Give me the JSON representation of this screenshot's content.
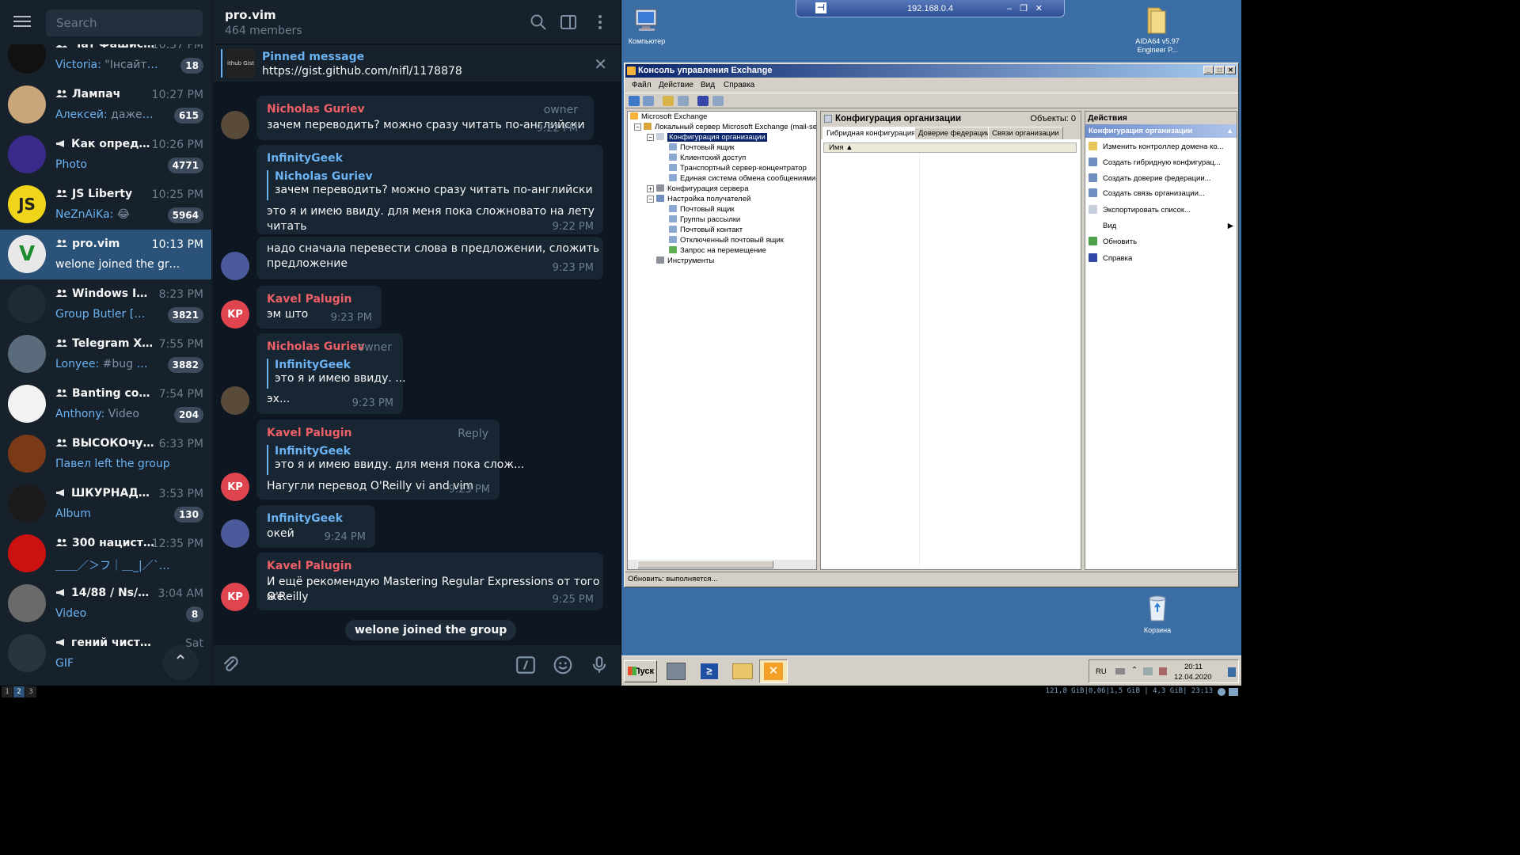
{
  "telegram": {
    "search_placeholder": "Search",
    "chats": [
      {
        "name": "Чат Фашисто...",
        "time": "10:37 PM",
        "sender": "Victoria:",
        "preview": " \"Інсайт\" як зав...",
        "badge": "18",
        "kind": "group",
        "avatar_color": "#111111",
        "avatar_text": "",
        "active": false
      },
      {
        "name": "Лампач",
        "time": "10:27 PM",
        "sender": "Алексей:",
        "preview": " даже не вып...",
        "badge": "615",
        "kind": "group",
        "avatar_color": "#c9a57a",
        "avatar_text": "",
        "active": false
      },
      {
        "name": "Как определи...",
        "time": "10:26 PM",
        "sender": "Photo",
        "preview": "",
        "badge": "4771",
        "kind": "channel",
        "avatar_color": "#3a2a8a",
        "avatar_text": "",
        "active": false
      },
      {
        "name": "JS Liberty",
        "time": "10:25 PM",
        "sender": "NeZnAiKa:",
        "preview": " 😂",
        "badge": "5964",
        "kind": "group",
        "avatar_color": "#f0d419",
        "avatar_text": "JS",
        "active": false
      },
      {
        "name": "pro.vim",
        "time": "10:13 PM",
        "sender": "welone joined the group",
        "preview": "",
        "badge": "",
        "kind": "group",
        "avatar_color": "#e8e8e8",
        "avatar_text": "V",
        "active": true
      },
      {
        "name": "Windows Inside...",
        "time": "8:23 PM",
        "sender": "Group Butler [beta]:",
        "preview": " ...",
        "badge": "3821",
        "kind": "group",
        "avatar_color": "#1f2a36",
        "avatar_text": "",
        "active": false
      },
      {
        "name": "Telegram X And...",
        "time": "7:55 PM",
        "sender": "Lonyee:",
        "preview": " #bug Telegra...",
        "badge": "3882",
        "kind": "group",
        "avatar_color": "#5a6b7c",
        "avatar_text": "",
        "active": false
      },
      {
        "name": "Banting cornerc...",
        "time": "7:54 PM",
        "sender": "Anthony:",
        "preview": " Video",
        "badge": "204",
        "kind": "group",
        "avatar_color": "#f2f2f2",
        "avatar_text": "",
        "active": false
      },
      {
        "name": "ВЫСОКОчувст...",
        "time": "6:33 PM",
        "sender": "Павел left the group",
        "preview": "",
        "badge": "",
        "kind": "group",
        "avatar_color": "#7a3a18",
        "avatar_text": "",
        "active": false
      },
      {
        "name": "ШКУРНАДЗОР",
        "time": "3:53 PM",
        "sender": "Album",
        "preview": "",
        "badge": "130",
        "kind": "channel",
        "avatar_color": "#1a1a1a",
        "avatar_text": "",
        "active": false
      },
      {
        "name": "300 нацистов",
        "time": "12:35 PM",
        "sender": "＿＿／＞フ｜＿_|／`ミ _x ...",
        "preview": "",
        "badge": "",
        "kind": "group",
        "avatar_color": "#cc1111",
        "avatar_text": "",
        "active": false
      },
      {
        "name": "14/88 / Ns/Wp P...",
        "time": "3:04 AM",
        "sender": "Video",
        "preview": "",
        "badge": "8",
        "kind": "channel",
        "avatar_color": "#6a6a6a",
        "avatar_text": "",
        "active": false
      },
      {
        "name": "гений чистой крас...",
        "time": "Sat",
        "sender": "GIF",
        "preview": "",
        "badge": "",
        "kind": "channel",
        "avatar_color": "#2a3440",
        "avatar_text": "",
        "active": false
      }
    ],
    "conversation": {
      "title": "pro.vim",
      "members": "464 members",
      "pinned_title": "Pinned message",
      "pinned_text": "https://gist.github.com/nifl/1178878",
      "pinned_thumb": "ithub Gist",
      "messages": [
        {
          "author": "Nicholas Guriev",
          "role": "owner",
          "text": "зачем переводить? можно сразу читать по-английски",
          "time": "9:22 PM"
        },
        {
          "author": "InfinityGeek",
          "quote_author": "Nicholas Guriev",
          "quote_text": "зачем переводить? можно сразу читать по-английски",
          "text": "это я и имею ввиду. для меня пока сложновато на лету читать",
          "time": "9:22 PM"
        },
        {
          "text_line1": "надо сначала перевести слова в предложении, сложить",
          "text_line2": "предложение",
          "time": "9:23 PM"
        },
        {
          "author": "Kavel Palugin",
          "avatar_text": "KP",
          "text": "эм што",
          "time": "9:23 PM"
        },
        {
          "author": "Nicholas Guriev",
          "role": "owner",
          "quote_author": "InfinityGeek",
          "quote_text": "это я и имею ввиду. ...",
          "text": "эх...",
          "time": "9:23 PM"
        },
        {
          "author": "Kavel Palugin",
          "avatar_text": "KP",
          "reply_label": "Reply",
          "quote_author": "InfinityGeek",
          "quote_text": "это я и имею ввиду. для меня пока слож...",
          "text": "Нагугли перевод O'Reilly vi and vim",
          "time": "9:23 PM"
        },
        {
          "author": "InfinityGeek",
          "text": "окей",
          "time": "9:24 PM"
        },
        {
          "author": "Kavel Palugin",
          "avatar_text": "KP",
          "text_line1": "И ещё рекомендую Mastering Regular Expressions от того же",
          "text_line2": "O'Reilly",
          "time": "9:25 PM"
        }
      ],
      "service_message": "welone joined the group"
    }
  },
  "windows": {
    "rdp_host": "192.168.0.4",
    "desktop_icons": {
      "computer": "Компьютер",
      "aida_line1": "AIDA64 v5.97",
      "aida_line2": "Engineer P...",
      "recycle": "Корзина"
    },
    "console": {
      "title": "Консоль управления Exchange",
      "menu": [
        "Файл",
        "Действие",
        "Вид",
        "Справка"
      ],
      "tree": [
        "Microsoft Exchange",
        "Локальный сервер Microsoft Exchange (mail-serve",
        "Конфигурация организации",
        "Почтовый ящик",
        "Клиентский доступ",
        "Транспортный сервер-концентратор",
        "Единая система обмена сообщениями",
        "Конфигурация сервера",
        "Настройка получателей",
        "Почтовый ящик",
        "Группы рассылки",
        "Почтовый контакт",
        "Отключенный почтовый ящик",
        "Запрос на перемещение",
        "Инструменты"
      ],
      "center_title": "Конфигурация организации",
      "center_count": "Объекты: 0",
      "tabs": [
        "Гибридная конфигурация",
        "Доверие федерации",
        "Связи организации"
      ],
      "column": "Имя",
      "actions_title": "Действия",
      "actions_sub": "Конфигурация организации",
      "actions": [
        "Изменить контроллер домена ко...",
        "Создать гибридную конфигурац...",
        "Создать доверие федерации...",
        "Создать связь организации...",
        "Экспортировать список...",
        "Вид",
        "Обновить",
        "Справка"
      ],
      "status": "Обновить: выполняется..."
    },
    "taskbar": {
      "start": "Пуск",
      "lang": "RU",
      "time": "20:11",
      "date": "12.04.2020"
    }
  },
  "statusbar": {
    "workspaces": [
      "1",
      "2",
      "3"
    ],
    "stats": "121,8 GiB|0,06|1,5 GiB | 4,3 GiB| 23:13"
  }
}
